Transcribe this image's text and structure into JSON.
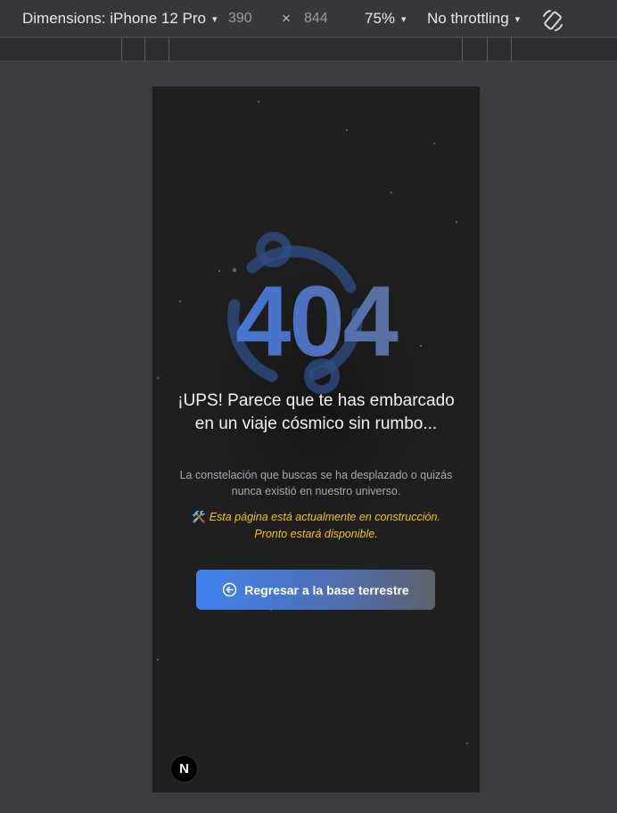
{
  "devtools": {
    "dimensions_label": "Dimensions: iPhone 12 Pro",
    "width": "390",
    "times": "×",
    "height": "844",
    "zoom": "75%",
    "throttling": "No throttling",
    "caret": "▾",
    "rotate_icon": "rotate-icon"
  },
  "page": {
    "error_code": "404",
    "headline": "¡UPS! Parece que te has embarcado en un viaje cósmico sin rumbo...",
    "subtext": "La constelación que buscas se ha desplazado o quizás nunca existió en nuestro universo.",
    "notice_icon": "🛠️",
    "notice": "Esta página está actualmente en construcción. Pronto estará disponible.",
    "cta_label": "Regresar a la base terrestre",
    "cta_icon": "arrow-left-circle-icon",
    "next_badge": "N"
  },
  "colors": {
    "accent_blue": "#3f82f0",
    "notice_yellow": "#f2c21b",
    "page_background": "#202021"
  }
}
